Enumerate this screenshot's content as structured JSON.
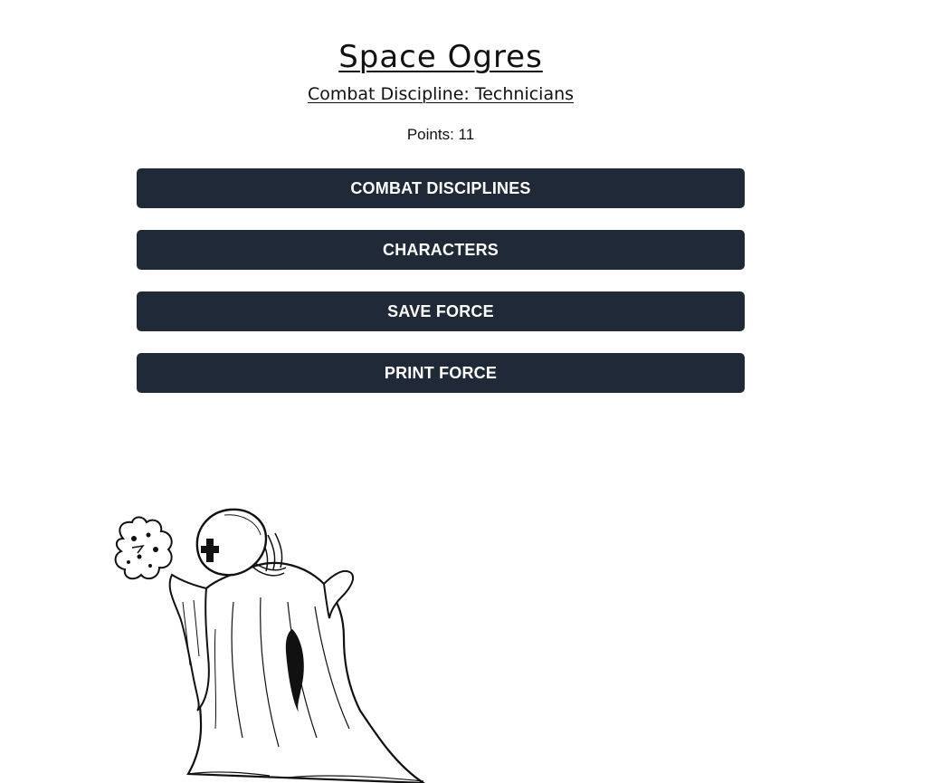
{
  "header": {
    "title": "Space Ogres",
    "subtitle": "Combat Discipline: Technicians"
  },
  "points": {
    "text": "Points: 11"
  },
  "actions": {
    "combat_disciplines_label": "COMBAT DISCIPLINES",
    "characters_label": "CHARACTERS",
    "save_force_label": "SAVE FORCE",
    "print_force_label": "PRINT FORCE"
  },
  "illustration": {
    "icon": "robed-technician-figure"
  },
  "colors": {
    "button_bg": "#1f2937",
    "button_text": "#ffffff",
    "background": "#ffffff"
  }
}
